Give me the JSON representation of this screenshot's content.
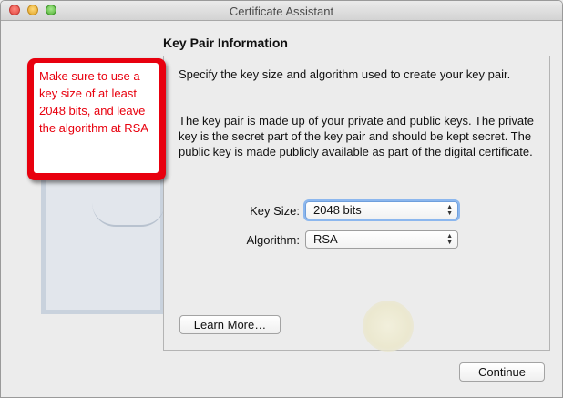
{
  "window": {
    "title": "Certificate Assistant"
  },
  "section": {
    "heading": "Key Pair Information"
  },
  "content": {
    "paragraph1": "Specify the key size and algorithm used to create your key pair.",
    "paragraph2": "The key pair is made up of your private and public keys. The private key is the secret part of the key pair and should be kept secret. The public key is made publicly available as part of the digital certificate."
  },
  "form": {
    "key_size": {
      "label": "Key Size:",
      "value": "2048 bits"
    },
    "algorithm": {
      "label": "Algorithm:",
      "value": "RSA"
    }
  },
  "buttons": {
    "learn_more": "Learn More…",
    "continue": "Continue"
  },
  "annotation": {
    "text": "Make sure to use a key size of at least 2048 bits, and leave the algorithm at RSA",
    "color": "#e8000e"
  },
  "icons": {
    "close": "close-icon",
    "minimize": "minimize-icon",
    "zoom": "zoom-icon",
    "popup_arrows": "up-down-arrows-icon"
  }
}
